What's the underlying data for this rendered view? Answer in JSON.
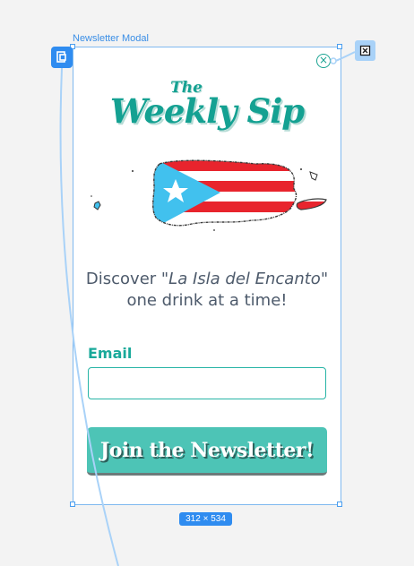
{
  "canvas": {
    "frame_label": "Newsletter Modal",
    "size_badge": "312 × 534"
  },
  "modal": {
    "logo_the": "The",
    "logo_main": "Weekly Sip",
    "tagline_prefix": "Discover ",
    "tagline_emphasis": "\"La Isla del Encanto\"",
    "tagline_suffix": "one drink at a time!",
    "email_label": "Email",
    "email_value": "",
    "email_placeholder": "",
    "join_label": "Join the Newsletter!",
    "close_glyph": "×"
  },
  "icons": {
    "close": "close-circle-icon",
    "flag_map": "puerto-rico-flag-map",
    "prototype_start": "prototype-link-icon",
    "prototype_target": "close-overlay-icon"
  },
  "colors": {
    "brand_teal": "#14a192",
    "button_teal": "#4dc4b6",
    "selection_blue": "#2f8cf0",
    "flag_red": "#e8242d",
    "flag_blue": "#41c1ee"
  }
}
